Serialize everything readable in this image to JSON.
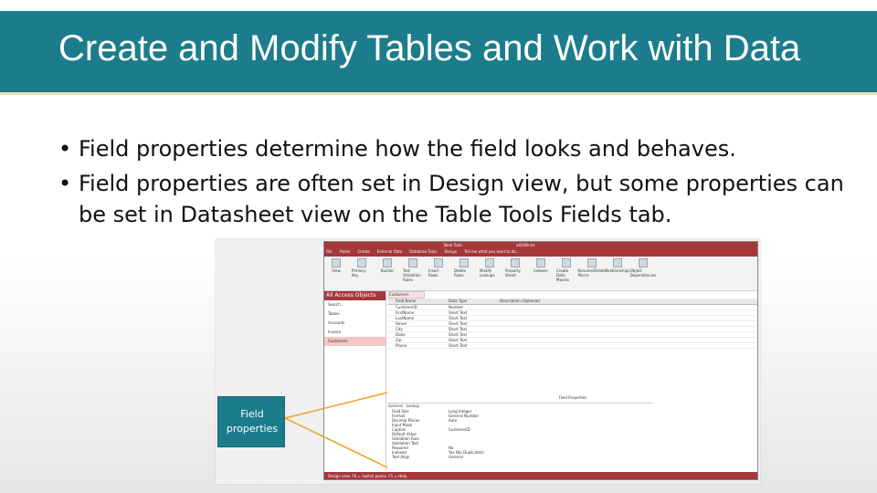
{
  "title": "Create and Modify Tables and Work with Data",
  "bullets": [
    "Field properties determine how the field looks and behaves.",
    "Field properties are often set in Design view, but some properties can be set in Datasheet view on the Table Tools Fields tab."
  ],
  "callout": {
    "line1": "Field",
    "line2": "properties"
  },
  "colors": {
    "accent": "#1c7c8c",
    "access_red": "#a4373a",
    "arrow": "#f0a020"
  },
  "screenshot": {
    "window_title": "a02ABrink",
    "context_tab": "Table Tools",
    "tabs": [
      "File",
      "Home",
      "Create",
      "External Data",
      "Database Tools",
      "Design"
    ],
    "tell_me": "Tell me what you want to do...",
    "ribbon_buttons": [
      "View",
      "Primary Key",
      "Builder",
      "Test Validation Rules",
      "Insert Rows",
      "Delete Rows",
      "Modify Lookups",
      "Property Sheet",
      "Indexes",
      "Create Data Macros",
      "Rename/Delete Macro",
      "Relationships",
      "Object Dependencies"
    ],
    "nav": {
      "header": "All Access Objects",
      "search": "Search...",
      "section": "Tables",
      "items": [
        "Accounts",
        "Invoice",
        "Customers"
      ]
    },
    "table_tab": "Customers",
    "columns": [
      "Field Name",
      "Data Type",
      "Description (Optional)"
    ],
    "rows": [
      [
        "CustomerID",
        "Number"
      ],
      [
        "FirstName",
        "Short Text"
      ],
      [
        "LastName",
        "Short Text"
      ],
      [
        "Street",
        "Short Text"
      ],
      [
        "City",
        "Short Text"
      ],
      [
        "State",
        "Short Text"
      ],
      [
        "Zip",
        "Short Text"
      ],
      [
        "Phone",
        "Short Text"
      ]
    ],
    "field_properties_label": "Field Properties",
    "property_tabs": [
      "General",
      "Lookup"
    ],
    "properties": [
      [
        "Field Size",
        "Long Integer"
      ],
      [
        "Format",
        "General Number"
      ],
      [
        "Decimal Places",
        "Auto"
      ],
      [
        "Input Mask",
        ""
      ],
      [
        "Caption",
        "CustomerID"
      ],
      [
        "Default Value",
        ""
      ],
      [
        "Validation Rule",
        ""
      ],
      [
        "Validation Text",
        ""
      ],
      [
        "Required",
        "No"
      ],
      [
        "Indexed",
        "Yes (No Duplicates)"
      ],
      [
        "Text Align",
        "General"
      ]
    ],
    "status": "Design view. F6 = Switch panes. F1 = Help."
  }
}
